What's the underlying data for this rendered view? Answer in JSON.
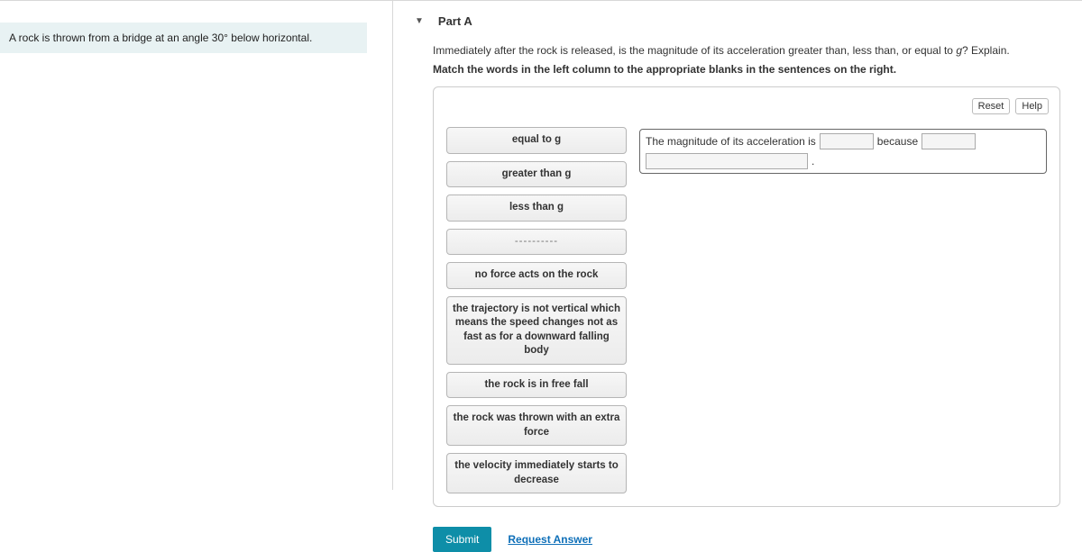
{
  "problem": {
    "prompt_html": "A rock is thrown from a bridge at an angle 30° below horizontal."
  },
  "part": {
    "label": "Part A",
    "question_pre": "Immediately after the rock is released, is the magnitude of its acceleration greater than, less than, or equal to ",
    "question_post": "? Explain.",
    "g_letter": "g",
    "instruction": "Match the words in the left column to the appropriate blanks in the sentences on the right."
  },
  "panel": {
    "reset": "Reset",
    "help": "Help"
  },
  "tiles": [
    "equal to g",
    "greater than g",
    "less than g",
    "----------",
    "no force acts on the rock",
    "the trajectory is not vertical which means the speed changes not as fast as for a downward falling body",
    "the rock is in free fall",
    "the rock was thrown with an extra force",
    "the velocity immediately starts to decrease"
  ],
  "sentence": {
    "s1": "The magnitude of its acceleration is",
    "s2": "because",
    "s3": "."
  },
  "actions": {
    "submit": "Submit",
    "request": "Request Answer"
  }
}
